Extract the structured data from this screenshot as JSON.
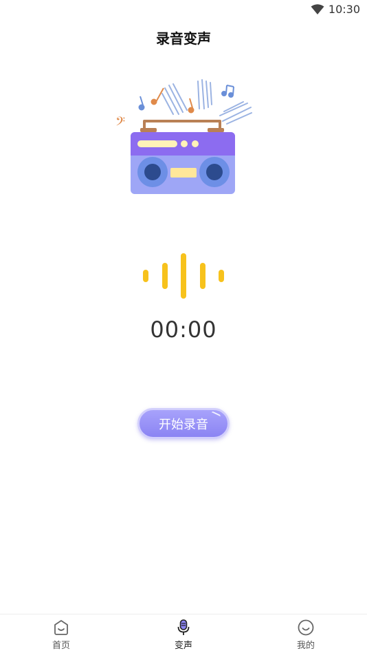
{
  "status_bar": {
    "time": "10:30",
    "wifi_icon": "wifi-icon"
  },
  "header": {
    "title": "录音变声"
  },
  "illustration": {
    "icon": "radio-boombox-illustration"
  },
  "recorder": {
    "timer": "00:00",
    "waveform_color": "#f7c21c",
    "button_label": "开始录音",
    "accent": "#8b84f3"
  },
  "bottom_nav": {
    "items": [
      {
        "label": "首页",
        "icon": "home-icon",
        "active": false
      },
      {
        "label": "变声",
        "icon": "microphone-icon",
        "active": true
      },
      {
        "label": "我的",
        "icon": "smile-profile-icon",
        "active": false
      }
    ]
  }
}
